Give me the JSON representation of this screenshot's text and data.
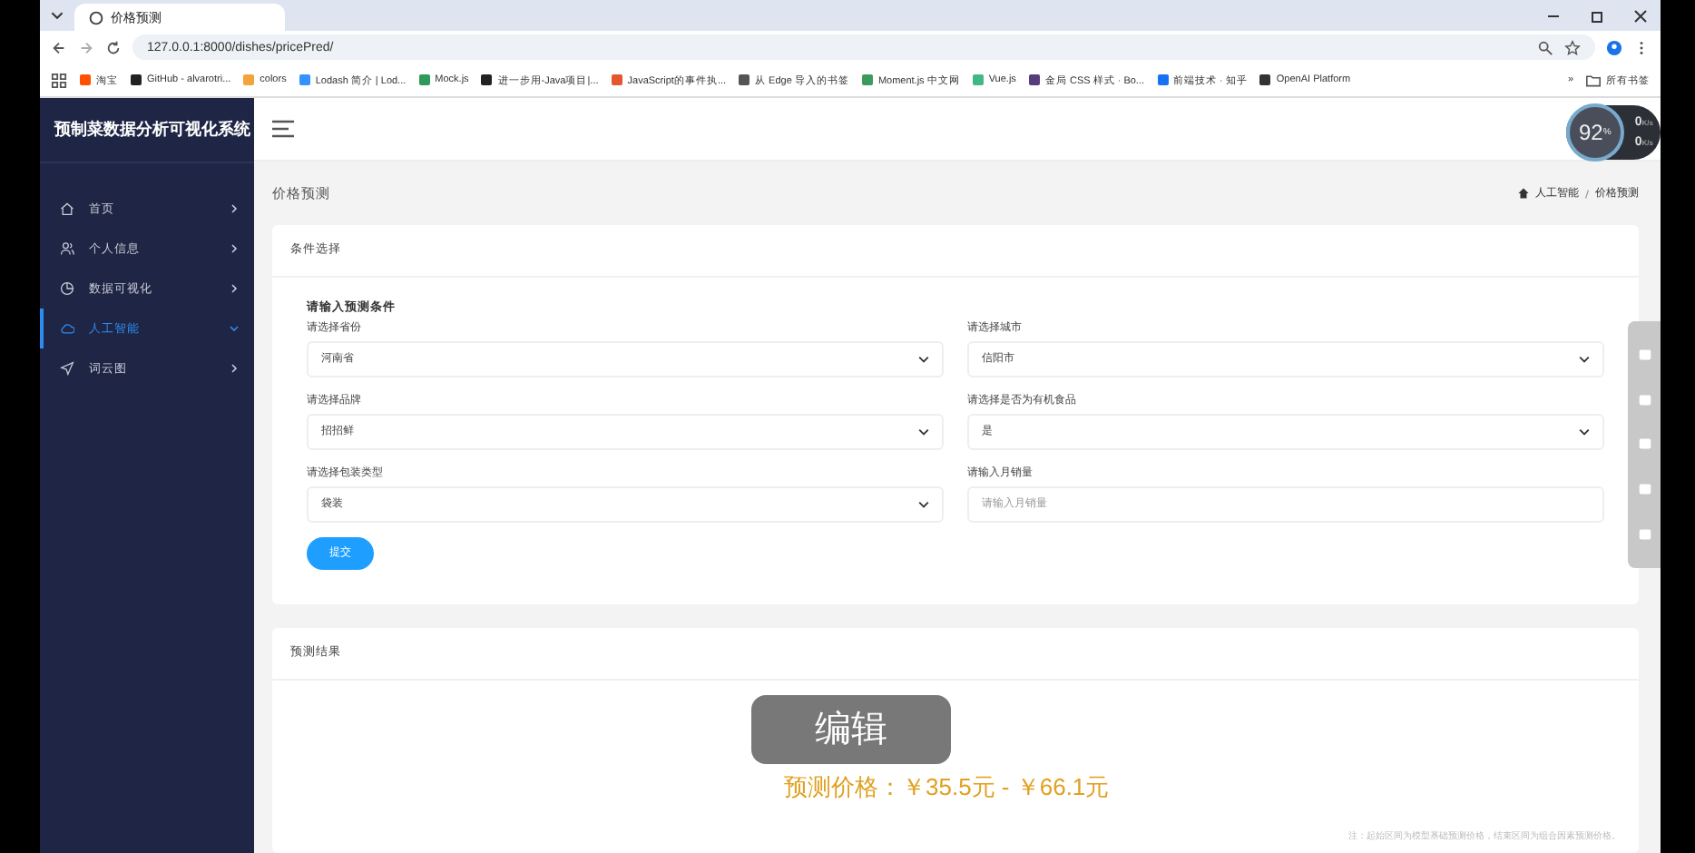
{
  "browser": {
    "tab_title": "价格预测",
    "url": "127.0.0.1:8000/dishes/pricePred/",
    "bookmarks": [
      {
        "label": "淘宝",
        "color": "#ff5000"
      },
      {
        "label": "GitHub - alvarotri...",
        "color": "#222222"
      },
      {
        "label": "colors",
        "color": "#f2a33a"
      },
      {
        "label": "Lodash 简介 | Lod...",
        "color": "#3492ff"
      },
      {
        "label": "Mock.js",
        "color": "#2e9a5a"
      },
      {
        "label": "进一步用-Java项目|...",
        "color": "#222222"
      },
      {
        "label": "JavaScript的事件执...",
        "color": "#e4572e"
      },
      {
        "label": "从 Edge 导入的书签",
        "color": "#555555"
      },
      {
        "label": "Moment.js 中文网",
        "color": "#3b9b5b"
      },
      {
        "label": "Vue.js",
        "color": "#41b883"
      },
      {
        "label": "金局 CSS 样式 · Bo...",
        "color": "#563d7c"
      },
      {
        "label": "前端技术 · 知乎",
        "color": "#1772f6"
      },
      {
        "label": "OpenAI Platform",
        "color": "#333333"
      }
    ],
    "more": "»",
    "all_bookmarks": "所有书签"
  },
  "sidebar": {
    "title": "预制菜数据分析可视化系统",
    "items": [
      {
        "label": "首页",
        "selected": false,
        "expanded": false
      },
      {
        "label": "个人信息",
        "selected": false,
        "expanded": false
      },
      {
        "label": "数据可视化",
        "selected": false,
        "expanded": false
      },
      {
        "label": "人工智能",
        "selected": true,
        "expanded": true
      },
      {
        "label": "词云图",
        "selected": false,
        "expanded": false
      }
    ]
  },
  "monitor": {
    "percent": "92",
    "unit": "%",
    "up": "0",
    "up_unit": "K/s",
    "down": "0",
    "down_unit": "K/s"
  },
  "page_title": "价格预测",
  "breadcrumb": [
    "人工智能",
    "价格预测"
  ],
  "condition_card": {
    "title": "条件选择",
    "heading": "请输入预测条件",
    "fields": [
      {
        "label": "请选择省份",
        "kind": "select",
        "value": "河南省"
      },
      {
        "label": "请选择城市",
        "kind": "select",
        "value": "信阳市"
      },
      {
        "label": "请选择品牌",
        "kind": "select",
        "value": "招招鲜"
      },
      {
        "label": "请选择是否为有机食品",
        "kind": "select",
        "value": "是"
      },
      {
        "label": "请选择包装类型",
        "kind": "select",
        "value": "袋装"
      },
      {
        "label": "请输入月销量",
        "kind": "input",
        "placeholder": "请输入月销量"
      }
    ],
    "submit": "提交"
  },
  "result_card": {
    "title": "预测结果",
    "label": "预测价格：",
    "price": "￥35.5元 - ￥66.1元",
    "note": "注：起始区间为模型基础预测价格，结束区间为组合因素预测价格。"
  },
  "overlay": {
    "label": "编辑"
  }
}
